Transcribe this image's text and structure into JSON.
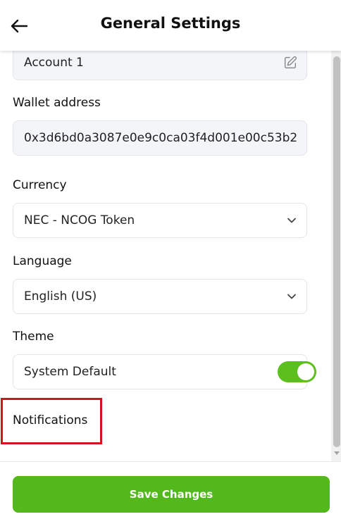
{
  "header": {
    "title": "General Settings",
    "back_icon": "arrow-left-icon"
  },
  "account": {
    "value": "Account 1",
    "edit_icon": "edit-icon"
  },
  "wallet_address": {
    "label": "Wallet address",
    "value": "0x3d6bd0a3087e0e9c0ca03f4d001e00c53b2"
  },
  "currency": {
    "label": "Currency",
    "value": "NEC - NCOG Token"
  },
  "language": {
    "label": "Language",
    "value": "English (US)"
  },
  "theme": {
    "label": "Theme",
    "value": "System Default"
  },
  "notifications": {
    "label": "Notifications",
    "enabled": true
  },
  "save_button": {
    "label": "Save Changes"
  },
  "colors": {
    "accent": "#52b81b",
    "toggle_on": "#5dbf1d",
    "highlight": "#d3141b",
    "field_bg": "#f3f5f8"
  }
}
